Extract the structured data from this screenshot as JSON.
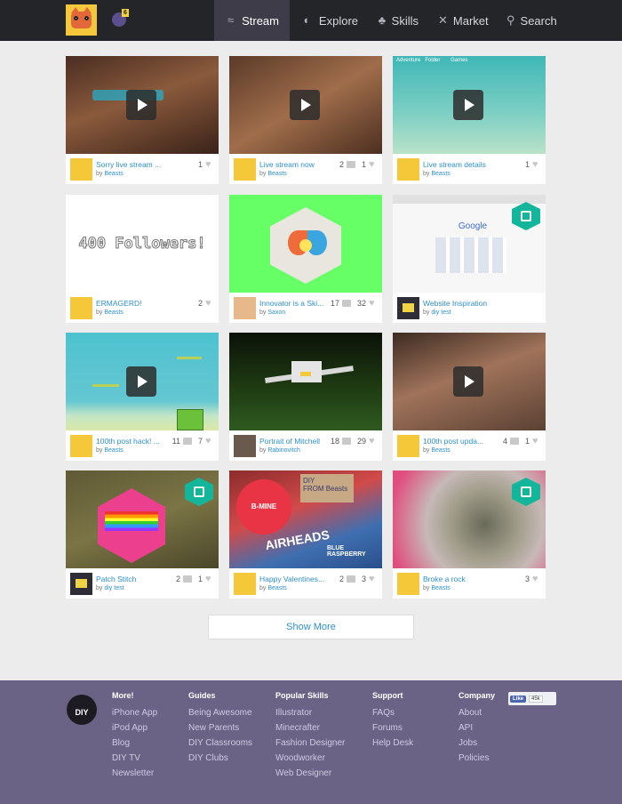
{
  "header": {
    "notification_count": "6",
    "nav": [
      {
        "label": "Stream",
        "icon": "stream-icon",
        "active": true
      },
      {
        "label": "Explore",
        "icon": "planet-icon",
        "active": false
      },
      {
        "label": "Skills",
        "icon": "skills-icon",
        "active": false
      },
      {
        "label": "Market",
        "icon": "tools-icon",
        "active": false
      },
      {
        "label": "Search",
        "icon": "search-icon",
        "active": false
      }
    ]
  },
  "thumb_overlay": {
    "tabs": [
      "Adventure",
      "Folder",
      "Games"
    ]
  },
  "thumb_text": {
    "followers": "400 Followers!",
    "google": "Google",
    "diy": "DIY",
    "from_beasts": "FROM Beasts",
    "b_mine": "B-MINE",
    "airheads": "AIRHEADS",
    "blue_raspberry": "BLUE RASPBERRY"
  },
  "cards": [
    {
      "title": "Sorry live stream ...",
      "by": "by",
      "author": "Beasts",
      "comments": "",
      "likes": "1"
    },
    {
      "title": "Live stream now",
      "by": "by",
      "author": "Beasts",
      "comments": "2",
      "likes": "1"
    },
    {
      "title": "Live stream details",
      "by": "by",
      "author": "Beasts",
      "comments": "",
      "likes": "1"
    },
    {
      "title": "ERMAGERD!",
      "by": "by",
      "author": "Beasts",
      "comments": "",
      "likes": "2"
    },
    {
      "title": "Innovator is a Ski...",
      "by": "by",
      "author": "Saxon",
      "comments": "17",
      "likes": "32"
    },
    {
      "title": "Website Inspiration",
      "by": "by",
      "author": "diy test",
      "comments": "",
      "likes": ""
    },
    {
      "title": "100th post hack! ...",
      "by": "by",
      "author": "Beasts",
      "comments": "11",
      "likes": "7"
    },
    {
      "title": "Portrait of Mitchell",
      "by": "by",
      "author": "Rabinovitch",
      "comments": "18",
      "likes": "29"
    },
    {
      "title": "100th post upda...",
      "by": "by",
      "author": "Beasts",
      "comments": "4",
      "likes": "1"
    },
    {
      "title": "Patch Stitch",
      "by": "by",
      "author": "diy test",
      "comments": "2",
      "likes": "1"
    },
    {
      "title": "Happy Valentines...",
      "by": "by",
      "author": "Beasts",
      "comments": "2",
      "likes": "3"
    },
    {
      "title": "Broke a rock",
      "by": "by",
      "author": "Beasts",
      "comments": "",
      "likes": "3"
    }
  ],
  "show_more": "Show More",
  "footer": {
    "logo_text": "DIY",
    "columns": [
      {
        "heading": "More!",
        "links": [
          "iPhone App",
          "iPod App",
          "Blog",
          "DIY TV",
          "Newsletter"
        ]
      },
      {
        "heading": "Guides",
        "links": [
          "Being Awesome",
          "New Parents",
          "DIY Classrooms",
          "DIY Clubs"
        ]
      },
      {
        "heading": "Popular Skills",
        "links": [
          "Illustrator",
          "Minecrafter",
          "Fashion Designer",
          "Woodworker",
          "Web Designer"
        ]
      },
      {
        "heading": "Support",
        "links": [
          "FAQs",
          "Forums",
          "Help Desk"
        ]
      },
      {
        "heading": "Company",
        "links": [
          "About",
          "API",
          "Jobs",
          "Policies"
        ]
      }
    ],
    "fb_like": {
      "label": "Like",
      "count": "45k"
    }
  },
  "colors": {
    "accent": "#2e8fd0",
    "header_bg": "#242528",
    "footer_bg": "#6b6385",
    "badge_teal": "#14b69b"
  }
}
